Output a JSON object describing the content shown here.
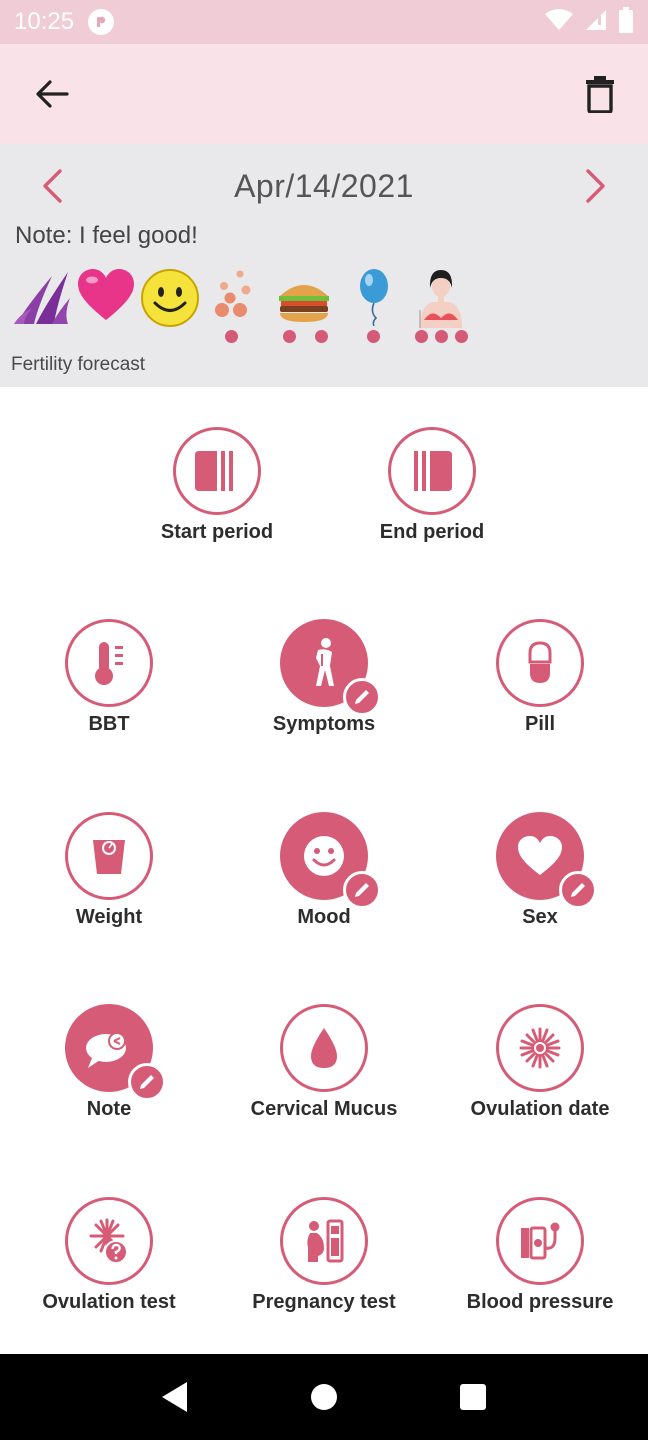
{
  "status_bar": {
    "time": "10:25"
  },
  "header": {
    "back_icon": "arrow-left-icon",
    "delete_icon": "trash-icon"
  },
  "summary": {
    "date": "Apr/14/2021",
    "note": "Note: I feel good!",
    "forecast_label": "Fertility forecast",
    "entries": [
      {
        "icon": "period-flow-icon",
        "dots": 0
      },
      {
        "icon": "heart-icon",
        "dots": 0
      },
      {
        "icon": "smiley-icon",
        "dots": 0
      },
      {
        "icon": "mucus-drops-icon",
        "dots": 1
      },
      {
        "icon": "burger-icon",
        "dots": 2
      },
      {
        "icon": "balloon-icon",
        "dots": 1
      },
      {
        "icon": "breast-tenderness-icon",
        "dots": 3
      }
    ]
  },
  "actions": [
    {
      "label": "Start period",
      "icon": "start-period-icon",
      "filled": false
    },
    {
      "label": "End period",
      "icon": "end-period-icon",
      "filled": false
    },
    {
      "label": "BBT",
      "icon": "thermometer-icon",
      "filled": false
    },
    {
      "label": "Symptoms",
      "icon": "symptoms-icon",
      "filled": true
    },
    {
      "label": "Pill",
      "icon": "pill-icon",
      "filled": false
    },
    {
      "label": "Weight",
      "icon": "scale-icon",
      "filled": false
    },
    {
      "label": "Mood",
      "icon": "mood-icon",
      "filled": true
    },
    {
      "label": "Sex",
      "icon": "heart-icon",
      "filled": true
    },
    {
      "label": "Note",
      "icon": "note-bubble-icon",
      "filled": true
    },
    {
      "label": "Cervical Mucus",
      "icon": "drop-icon",
      "filled": false
    },
    {
      "label": "Ovulation date",
      "icon": "ovulation-flower-icon",
      "filled": false
    },
    {
      "label": "Ovulation test",
      "icon": "ovulation-test-icon",
      "filled": false
    },
    {
      "label": "Pregnancy test",
      "icon": "pregnancy-test-icon",
      "filled": false
    },
    {
      "label": "Blood pressure",
      "icon": "blood-pressure-icon",
      "filled": false
    }
  ],
  "colors": {
    "accent": "#d65b76",
    "status_bar": "#f0cdd6",
    "app_bar": "#f9e3e8",
    "summary_bg": "#e9e9ec"
  }
}
